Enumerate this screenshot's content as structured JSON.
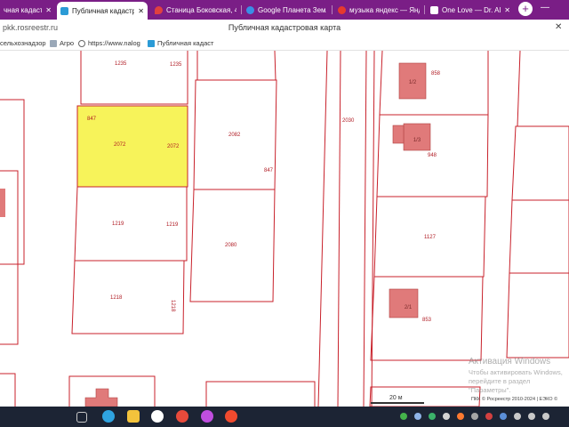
{
  "tabs": [
    {
      "title": "чная кадастровая",
      "active": false,
      "close": "✕",
      "icon": "page-icon",
      "color": "#2f7bd6"
    },
    {
      "title": "Публичная кадастро",
      "active": true,
      "close": "✕",
      "icon": "rosreestr-icon",
      "color": "#2b9bd6"
    },
    {
      "title": "Станица Боковская, 45",
      "active": false,
      "close": "",
      "icon": "map-pin-icon",
      "color": "#e04040"
    },
    {
      "title": "Google Планета Земля",
      "active": false,
      "close": "",
      "icon": "earth-icon",
      "color": "#3a8ee6"
    },
    {
      "title": "музыка яндекс — Янде",
      "active": false,
      "close": "",
      "icon": "yandex-icon",
      "color": "#e63a2e"
    },
    {
      "title": "One Love — Dr. Al",
      "active": false,
      "close": "✕",
      "icon": "music-icon",
      "color": "#ffffff"
    }
  ],
  "new_tab_label": "+",
  "window_controls": {
    "minimize": "—",
    "close": "✕"
  },
  "address": {
    "url": "pkk.rosreestr.ru",
    "page_title": "Публичная кадастровая карта"
  },
  "bookmarks": [
    {
      "label": "сельхознадзор",
      "icon": "page-icon"
    },
    {
      "label": "Агро",
      "icon": "agro-icon"
    },
    {
      "label": "https://www.nalog",
      "icon": "globe-icon"
    },
    {
      "label": "Публичная кадаст",
      "icon": "rosreestr-icon"
    }
  ],
  "map": {
    "highlight_color": "#f7f35a",
    "plot_color": "#c8212b",
    "labels": [
      {
        "id": "1235a",
        "text": "1235"
      },
      {
        "id": "1235b",
        "text": "1235"
      },
      {
        "id": "847a",
        "text": "847"
      },
      {
        "id": "2072a",
        "text": "2072"
      },
      {
        "id": "2072b",
        "text": "2072"
      },
      {
        "id": "2082",
        "text": "2082"
      },
      {
        "id": "847b",
        "text": "847"
      },
      {
        "id": "2030",
        "text": "2030"
      },
      {
        "id": "858",
        "text": "858"
      },
      {
        "id": "948",
        "text": "948"
      },
      {
        "id": "1219a",
        "text": "1219"
      },
      {
        "id": "1219b",
        "text": "1219"
      },
      {
        "id": "2080",
        "text": "2080"
      },
      {
        "id": "1127",
        "text": "1127"
      },
      {
        "id": "1218a",
        "text": "1218"
      },
      {
        "id": "1218b",
        "text": "1218"
      },
      {
        "id": "853",
        "text": "853"
      }
    ],
    "building_labels": [
      "1/2",
      "1/3",
      "2/1"
    ],
    "scale": "20 м",
    "copyright": "ПКК © Росреестр 2010-2024 | ЕЭКО ©"
  },
  "activation_watermark": {
    "title": "Активация Windows",
    "text": "Чтобы активировать Windows, перейдите в раздел \"Параметры\"."
  },
  "taskbar": {
    "icons": [
      "task-view-icon",
      "edge-icon",
      "file-explorer-icon",
      "yandex-browser-icon",
      "chrome-icon",
      "opera-icon",
      "yandex-icon"
    ]
  }
}
